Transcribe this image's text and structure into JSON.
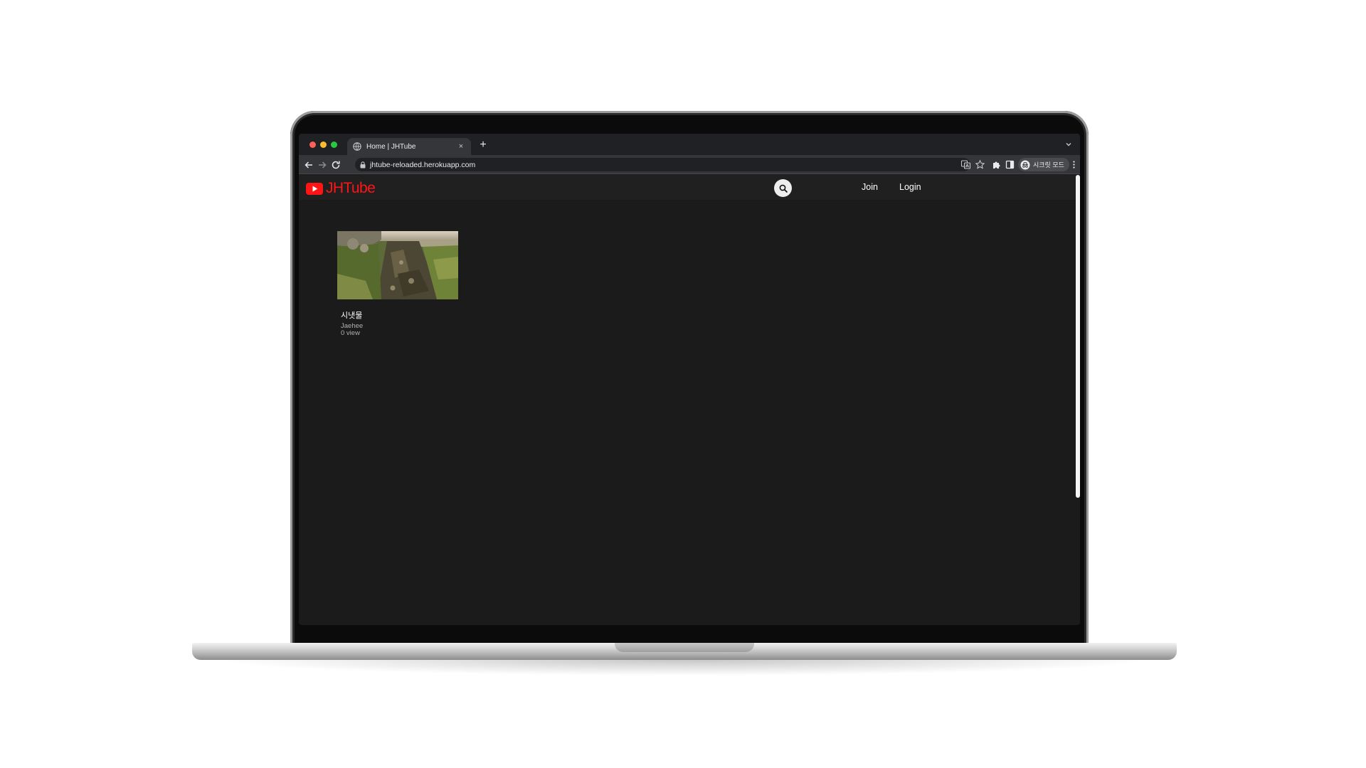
{
  "browser": {
    "tab_title": "Home | JHTube",
    "new_tab_symbol": "+",
    "tab_close_symbol": "×",
    "url": "jhtube-reloaded.herokuapp.com",
    "incognito_label": "시크릿 모드",
    "traffic_light_colors": [
      "#ff5f57",
      "#febc2e",
      "#28c840"
    ],
    "icons": [
      "back-icon",
      "forward-icon",
      "reload-icon",
      "lock-icon",
      "translate-icon",
      "bookmark-star-icon",
      "extensions-icon",
      "side-panel-icon",
      "incognito-icon",
      "more-menu-icon",
      "tab-list-chevron-icon"
    ]
  },
  "site": {
    "logo_text": "JHTube",
    "brand_color": "#ff1515",
    "nav": {
      "join": "Join",
      "login": "Login"
    }
  },
  "videos": [
    {
      "title": "시냇물",
      "owner": "Jaehee",
      "views": "0 view"
    }
  ]
}
